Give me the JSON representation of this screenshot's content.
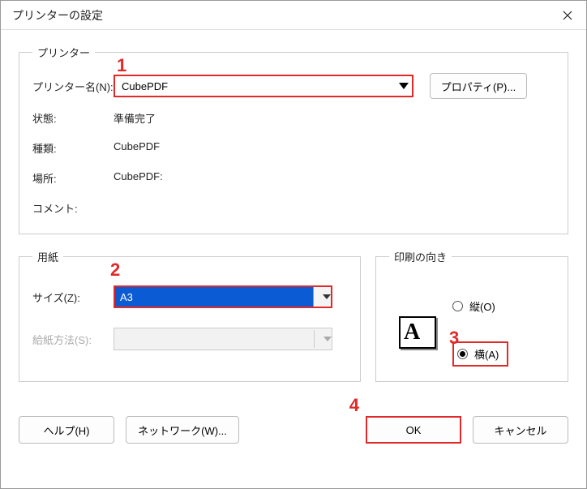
{
  "window": {
    "title": "プリンターの設定"
  },
  "groups": {
    "printer": "プリンター",
    "paper": "用紙",
    "orientation": "印刷の向き"
  },
  "printer": {
    "name_label": "プリンター名(N):",
    "name_value": "CubePDF",
    "properties_label": "プロパティ(P)...",
    "status_label": "状態:",
    "status_value": "準備完了",
    "type_label": "種類:",
    "type_value": "CubePDF",
    "location_label": "場所:",
    "location_value": "CubePDF:",
    "comment_label": "コメント:",
    "comment_value": ""
  },
  "paper": {
    "size_label": "サイズ(Z):",
    "size_value": "A3",
    "source_label": "給紙方法(S):",
    "source_value": ""
  },
  "orientation": {
    "portrait_label": "縦(O)",
    "landscape_label": "横(A)",
    "preview_letter": "A",
    "selected": "landscape"
  },
  "buttons": {
    "help": "ヘルプ(H)",
    "network": "ネットワーク(W)...",
    "ok": "OK",
    "cancel": "キャンセル"
  },
  "annotations": {
    "a1": "1",
    "a2": "2",
    "a3": "3",
    "a4": "4"
  }
}
